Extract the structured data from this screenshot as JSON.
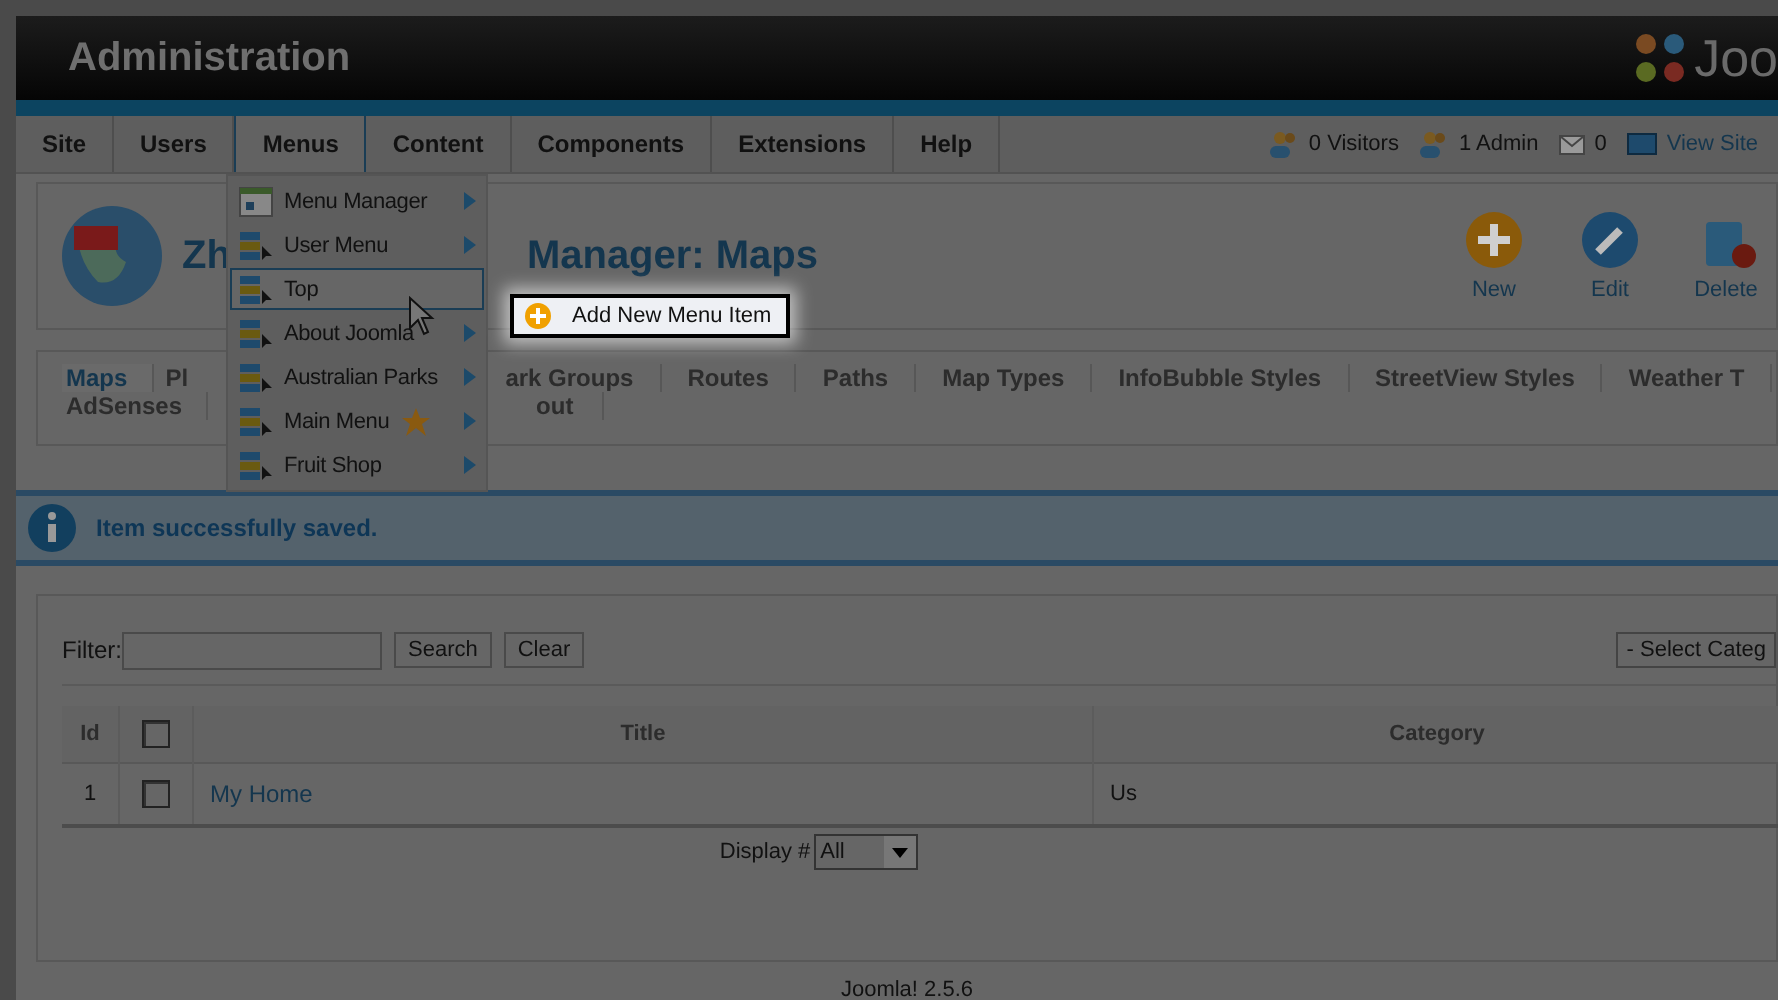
{
  "header": {
    "title": "Administration",
    "logo_text": "Joo"
  },
  "nav": {
    "items": [
      {
        "label": "Site",
        "selected": false
      },
      {
        "label": "Users",
        "selected": false
      },
      {
        "label": "Menus",
        "selected": true
      },
      {
        "label": "Content",
        "selected": false
      },
      {
        "label": "Components",
        "selected": false
      },
      {
        "label": "Extensions",
        "selected": false
      },
      {
        "label": "Help",
        "selected": false
      }
    ],
    "status": [
      {
        "kind": "visitors",
        "text": "0 Visitors"
      },
      {
        "kind": "admin",
        "text": "1 Admin"
      },
      {
        "kind": "messages",
        "text": "0"
      },
      {
        "kind": "site",
        "text": "View Site"
      }
    ]
  },
  "menu_dropdown": {
    "items": [
      {
        "label": "Menu Manager",
        "kind": "manager",
        "submenu": true,
        "highlighted": false,
        "default": false
      },
      {
        "label": "User Menu",
        "kind": "menu",
        "submenu": true,
        "highlighted": false,
        "default": false
      },
      {
        "label": "Top",
        "kind": "menu",
        "submenu": false,
        "highlighted": true,
        "default": false
      },
      {
        "label": "About Joomla",
        "kind": "menu",
        "submenu": true,
        "highlighted": false,
        "default": false
      },
      {
        "label": "Australian Parks",
        "kind": "menu",
        "submenu": true,
        "highlighted": false,
        "default": false
      },
      {
        "label": "Main Menu",
        "kind": "menu",
        "submenu": true,
        "highlighted": false,
        "default": true
      },
      {
        "label": "Fruit Shop",
        "kind": "menu",
        "submenu": true,
        "highlighted": false,
        "default": false
      }
    ]
  },
  "popup": {
    "label": "Add New Menu Item"
  },
  "page_title": {
    "before": "Zh",
    "after": "Manager: Maps"
  },
  "toolbar": [
    {
      "kind": "new",
      "label": "New"
    },
    {
      "kind": "edit",
      "label": "Edit"
    },
    {
      "kind": "delete",
      "label": "Delete"
    }
  ],
  "subtabs": {
    "row_1": [
      {
        "label": "Maps",
        "selected": true
      },
      {
        "label": "Pl",
        "selected": false
      },
      {
        "label": "ark Groups",
        "selected": false
      },
      {
        "label": "Routes",
        "selected": false
      },
      {
        "label": "Paths",
        "selected": false
      },
      {
        "label": "Map Types",
        "selected": false
      },
      {
        "label": "InfoBubble Styles",
        "selected": false
      },
      {
        "label": "StreetView Styles",
        "selected": false
      },
      {
        "label": "Weather T",
        "selected": false
      }
    ],
    "row_2": [
      {
        "label": "AdSenses",
        "selected": false
      },
      {
        "label": "out",
        "selected": false
      }
    ]
  },
  "message": "Item successfully saved.",
  "filter": {
    "label": "Filter:",
    "search": "Search",
    "clear": "Clear",
    "category": "- Select Categ"
  },
  "table": {
    "columns": [
      "Id",
      "Title",
      "Category"
    ],
    "rows": [
      {
        "id": "1",
        "title": "My Home",
        "category": "Us",
        "checked": false
      }
    ],
    "all_checked": false
  },
  "display": {
    "label": "Display #",
    "value": "All"
  },
  "footer": "Joomla! 2.5.6"
}
